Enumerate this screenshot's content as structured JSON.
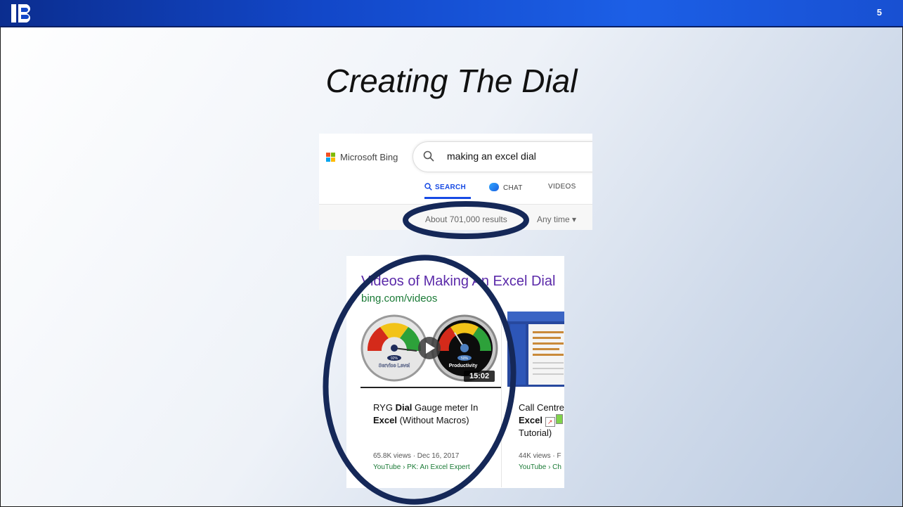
{
  "slide": {
    "page_number": "5",
    "title": "Creating The Dial",
    "accent_color": "#1247c8",
    "annotation_color": "#152858"
  },
  "bing": {
    "brand": "Microsoft Bing",
    "query": "making an excel dial",
    "tabs": [
      "SEARCH",
      "CHAT",
      "VIDEOS"
    ],
    "active_tab": "SEARCH",
    "results_count": "About 701,000 results",
    "time_filter": "Any time"
  },
  "videos": {
    "heading": "Videos of Making An Excel Dial",
    "source_url": "bing.com/videos",
    "items": [
      {
        "title_plain": "RYG ",
        "title_bold": "Dial",
        "title_rest": " Gauge meter In",
        "title_line2_bold": "Excel",
        "title_line2_rest": " (Without Macros)",
        "meta": "65.8K views · Dec 16, 2017",
        "source": "YouTube › PK: An Excel Expert",
        "duration": "15:02",
        "gauge_labels": [
          "Service Level",
          "Productivity"
        ],
        "gauge_values": [
          "92%",
          "50%"
        ]
      },
      {
        "title_plain": "Call Centre",
        "title_line2_bold": "Excel",
        "title_line3": "Tutorial)",
        "meta": "44K views · F",
        "source": "YouTube › Ch"
      }
    ]
  }
}
